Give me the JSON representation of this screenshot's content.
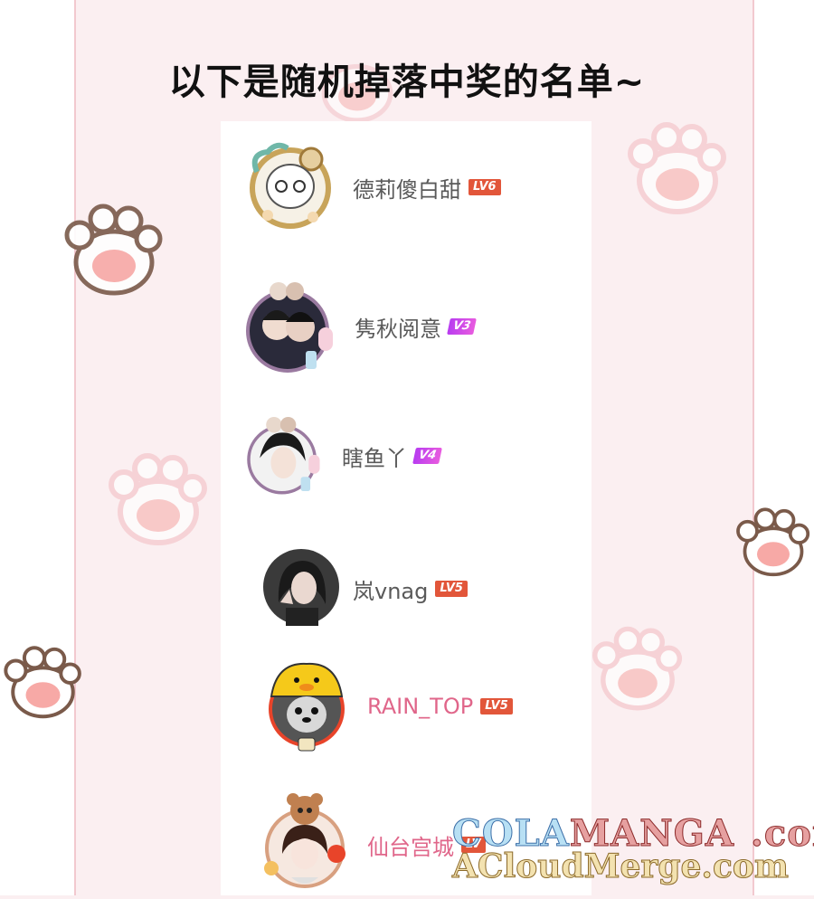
{
  "title": "以下是随机掉落中奖的名单~",
  "winners": [
    {
      "name": "德莉傻白甜",
      "badge": "LV6",
      "badge_type": "lv",
      "avatar_icon": "ghost-character-avatar-icon"
    },
    {
      "name": "隽秋阅意",
      "badge": "V3",
      "badge_type": "v",
      "avatar_icon": "anime-couple-avatar-icon"
    },
    {
      "name": "瞎鱼丫",
      "badge": "V4",
      "badge_type": "v",
      "avatar_icon": "anime-girl-avatar-icon"
    },
    {
      "name": "岚vnag",
      "badge": "LV5",
      "badge_type": "lv",
      "avatar_icon": "girl-photo-avatar-icon"
    },
    {
      "name": "RAIN_TOP",
      "badge": "LV5",
      "badge_type": "lv",
      "avatar_icon": "duck-hat-dog-avatar-icon"
    },
    {
      "name": "仙台宫城",
      "badge": "LV",
      "badge_type": "lv",
      "avatar_icon": "bear-girl-avatar-icon"
    }
  ],
  "watermark": {
    "line1_a": "COLA",
    "line1_b": "MANGA",
    "line1_c": ".com",
    "line2": "ACloudMerge.com"
  },
  "colors": {
    "background": "#fbeff1",
    "paw_pad": "#f7a9a6",
    "paw_outline": "#7a5a4a",
    "lv_badge": "#e2563a",
    "v_badge": "#c445ee",
    "pink_name": "#e0668a"
  }
}
